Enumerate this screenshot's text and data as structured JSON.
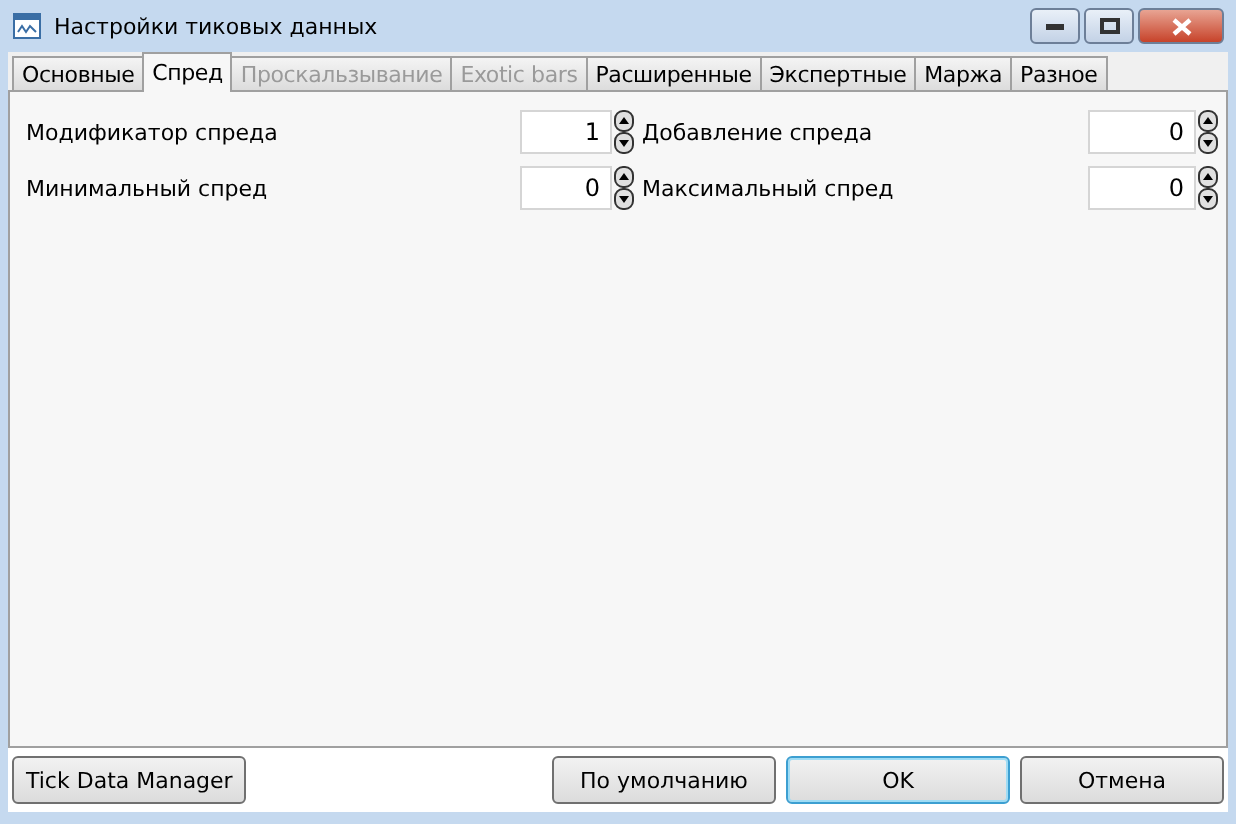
{
  "window": {
    "title": "Настройки тиковых данных"
  },
  "tabs": [
    {
      "label": "Основные",
      "selected": false,
      "disabled": false
    },
    {
      "label": "Спред",
      "selected": true,
      "disabled": false
    },
    {
      "label": "Проскальзывание",
      "selected": false,
      "disabled": true
    },
    {
      "label": "Exotic bars",
      "selected": false,
      "disabled": true
    },
    {
      "label": "Расширенные",
      "selected": false,
      "disabled": false
    },
    {
      "label": "Экспертные",
      "selected": false,
      "disabled": false
    },
    {
      "label": "Маржа",
      "selected": false,
      "disabled": false
    },
    {
      "label": "Разное",
      "selected": false,
      "disabled": false
    }
  ],
  "fields": [
    {
      "label": "Модификатор спреда",
      "value": "1"
    },
    {
      "label": "Добавление спреда",
      "value": "0"
    },
    {
      "label": "Минимальный спред",
      "value": "0"
    },
    {
      "label": "Максимальный спред",
      "value": "0"
    }
  ],
  "buttons": [
    {
      "label": "Tick Data Manager",
      "default": false
    },
    {
      "label": "По умолчанию",
      "default": false
    },
    {
      "label": "OK",
      "default": true
    },
    {
      "label": "Отмена",
      "default": false
    }
  ]
}
